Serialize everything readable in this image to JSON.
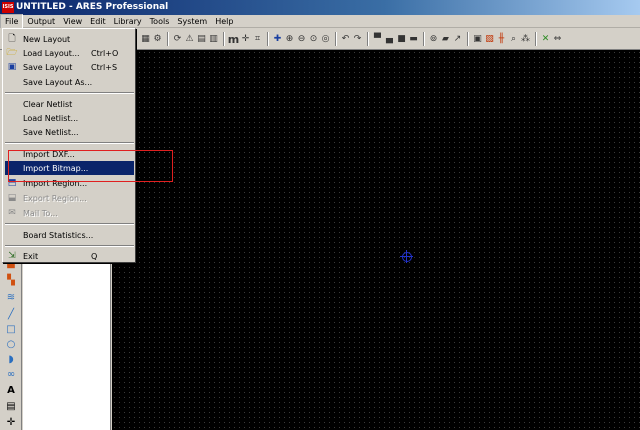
{
  "window": {
    "app_icon": "ISIS",
    "title": "UNTITLED - ARES Professional"
  },
  "menubar": [
    "File",
    "Output",
    "View",
    "Edit",
    "Library",
    "Tools",
    "System",
    "Help"
  ],
  "file_menu": {
    "new_layout": "New Layout",
    "load_layout": "Load Layout...",
    "load_layout_shortcut": "Ctrl+O",
    "save_layout": "Save Layout",
    "save_layout_shortcut": "Ctrl+S",
    "save_layout_as": "Save Layout As...",
    "clear_netlist": "Clear Netlist",
    "load_netlist": "Load Netlist...",
    "save_netlist": "Save Netlist...",
    "import_dxf": "Import DXF...",
    "import_bitmap": "Import Bitmap...",
    "import_region": "Import Region...",
    "export_region": "Export Region...",
    "mail_to": "Mail To...",
    "board_statistics": "Board Statistics...",
    "exit": "Exit",
    "exit_shortcut": "Q"
  },
  "icons": {
    "new": "new-document-icon",
    "load": "open-folder-icon",
    "save": "floppy-disk-icon",
    "import_region": "import-region-icon",
    "export_region": "export-region-icon",
    "mail": "mail-icon",
    "exit": "exit-icon"
  },
  "colors": {
    "highlight": "#0a246a",
    "canvas": "#000000",
    "annotation_box": "#e02020",
    "origin_marker": "#2233cc"
  }
}
